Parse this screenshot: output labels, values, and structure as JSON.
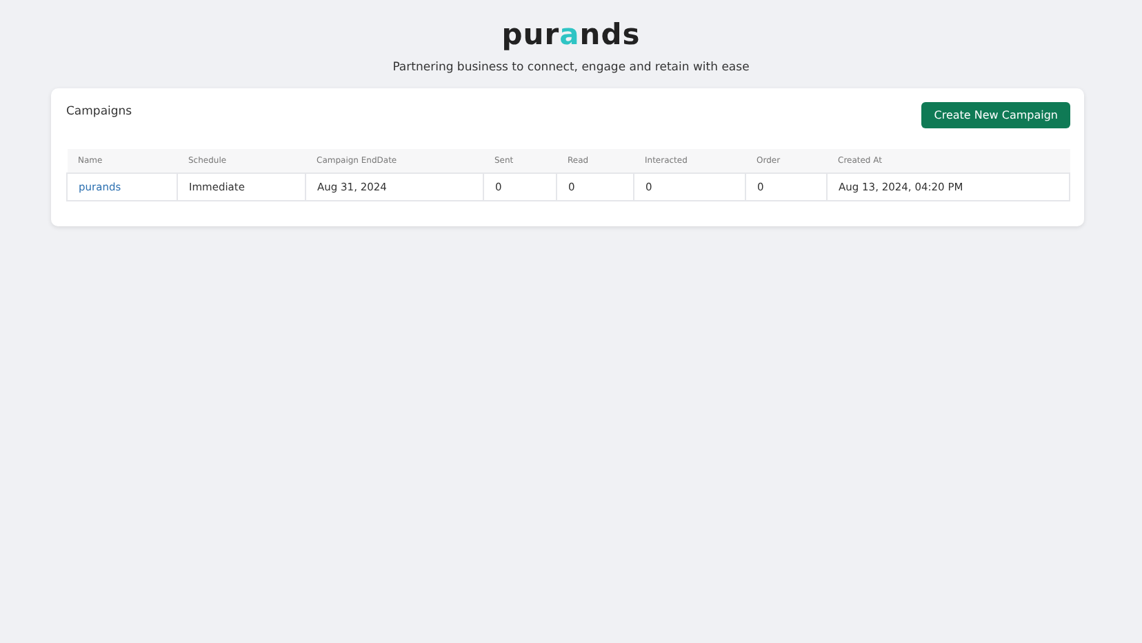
{
  "header": {
    "logo": [
      {
        "text": "pur",
        "accent": false
      },
      {
        "text": "a",
        "accent": true
      },
      {
        "text": "nds",
        "accent": false
      }
    ],
    "tagline": "Partnering business to connect, engage and retain with ease"
  },
  "card": {
    "title": "Campaigns",
    "button": "Create New Campaign",
    "table": {
      "columns": [
        "Name",
        "Schedule",
        "Campaign EndDate",
        "Sent",
        "Read",
        "Interacted",
        "Order",
        "Created At"
      ],
      "rows": [
        [
          {
            "text": "purands",
            "kind": "link"
          },
          {
            "text": "Immediate",
            "kind": "text"
          },
          {
            "text": "Aug 31, 2024",
            "kind": "text"
          },
          {
            "text": "0",
            "kind": "text"
          },
          {
            "text": "0",
            "kind": "text"
          },
          {
            "text": "0",
            "kind": "text"
          },
          {
            "text": "0",
            "kind": "text"
          },
          {
            "text": "Aug 13, 2024, 04:20 PM",
            "kind": "text"
          }
        ]
      ]
    }
  }
}
